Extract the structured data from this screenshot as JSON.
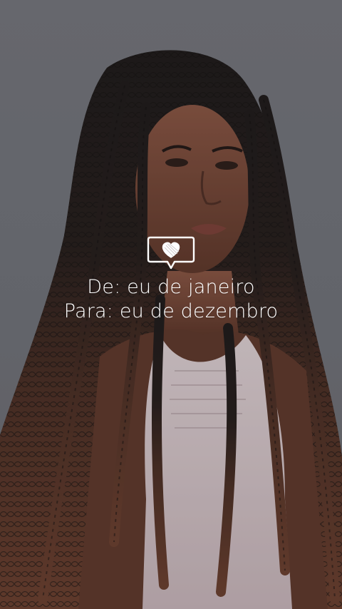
{
  "story": {
    "caption": {
      "line1": "De: eu de janeiro",
      "line2": "Para: eu de dezembro"
    },
    "sticker_icon": "heart-speech-bubble-icon",
    "photo_subject": "woman-with-long-twists-portrait",
    "colors": {
      "background": "#72747a",
      "text": "#ffffff",
      "hair_dark": "#1c1614",
      "hair_ombre": "#6b3d2b",
      "skin": "#7a4a36",
      "top": "#dccdd0"
    }
  }
}
